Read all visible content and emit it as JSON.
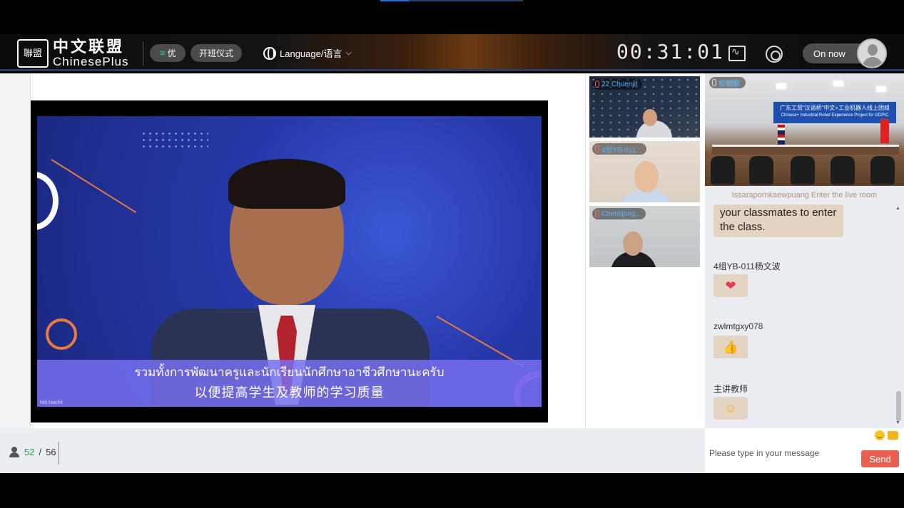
{
  "header": {
    "logo_seal": "聯盟",
    "logo_cn": "中文联盟",
    "logo_en": "ChinesePlus",
    "quality_label": "优",
    "ceremony_label": "开班仪式",
    "language_label": "Language/语言",
    "timer": "00:31:01",
    "status_label": "On now"
  },
  "stage": {
    "caption_thai": "รวมทั้งการพัฒนาครูและนักเรียนนักศึกษาอาชีวศึกษานะครับ",
    "caption_cn": "以便提高学生及教师的学习质量",
    "speaker_name": "Niti Nachit"
  },
  "participants": [
    {
      "name": "22 Chuenjit"
    },
    {
      "name": "4组YB-011..."
    },
    {
      "name": "Chenliping..."
    }
  ],
  "teacher_video": {
    "name": "黎明眼",
    "banner_line1": "广东工贸“汉语桥”中文+工业机器人线上团组",
    "banner_line2": "Chinese+ Industrial Robot Experience Project for GDPIC"
  },
  "chat": {
    "notice": "Issarapornkaewpuang Enter the live room",
    "partial_message": "your classmates to enter the class.",
    "messages": [
      {
        "user": "4组YB-011杨文波",
        "emoji": "hearts-emoji"
      },
      {
        "user": "zwlmtgxy078",
        "emoji": "thumbs-up-emoji"
      },
      {
        "user": "主讲教师",
        "emoji": "smiley-emoji"
      }
    ],
    "input_placeholder": "Please type in your message",
    "send_label": "Send"
  },
  "attendance": {
    "present": "52",
    "separator": "/",
    "total": "56"
  },
  "colors": {
    "send_button": "#e8604f",
    "header_border": "#2c3a66",
    "caption_bg": "#786ef0",
    "present_count": "#2a9d4b"
  }
}
